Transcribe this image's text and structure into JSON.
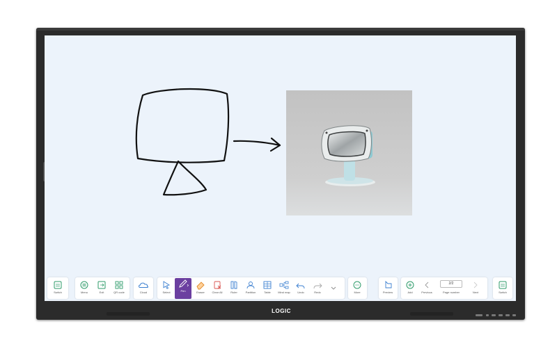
{
  "brand": {
    "logo": "LOGIC"
  },
  "colors": {
    "screen_bg": "#ecf3fb",
    "accent": "#6b3fa0",
    "icon_green": "#2e9b6a",
    "icon_blue": "#3b7fd0"
  },
  "canvas": {
    "sketch_desc_icon": "hand-drawn-monitor",
    "image_icon": "retro-monitor-photo"
  },
  "toolbar": {
    "left_switch": "Switch",
    "menu": "Menu",
    "exit": "Exit",
    "qr_code": "QR code",
    "cloud": "Cloud",
    "select": "Select",
    "pen": "Pen",
    "eraser": "Eraser",
    "clear_all": "Clear All",
    "ruler": "Ruler",
    "partition": "Partition",
    "table": "Table",
    "mind_map": "Mind map",
    "undo": "Undo",
    "redo": "Redo",
    "more": "More",
    "preview": "Preview",
    "add": "Add",
    "previous": "Previous",
    "page_value": "2/2",
    "page_number": "Page number",
    "next": "Next",
    "right_switch": "Switch"
  }
}
